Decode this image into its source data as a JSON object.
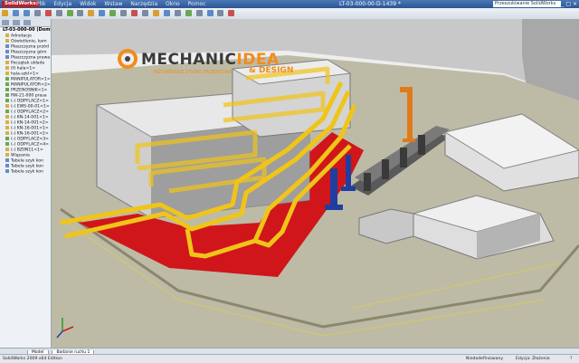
{
  "app": {
    "name": "SolidWorks",
    "menu": [
      "Plik",
      "Edycja",
      "Widok",
      "Wstaw",
      "Narzędzia",
      "Okno",
      "Pomoc"
    ],
    "document_title": "LT-03-000-00-D-1439 *",
    "search_placeholder": "Przeszukiwanie SolidWorks",
    "window_buttons": "_ □ ×"
  },
  "tree": {
    "root": "LT-03-000-00 (Domy",
    "items": [
      {
        "label": "Adnotacje",
        "icon": "annotation-icon"
      },
      {
        "label": "Oświetlenie, kam",
        "icon": "lights-icon"
      },
      {
        "label": "Płaszczyzna przód",
        "icon": "plane-icon"
      },
      {
        "label": "Płaszczyzna górn",
        "icon": "plane-icon"
      },
      {
        "label": "Płaszczyzna prawa",
        "icon": "plane-icon"
      },
      {
        "label": "Początek układu",
        "icon": "origin-icon"
      },
      {
        "label": "(f) hala<1>",
        "icon": "part-icon"
      },
      {
        "label": "hala-szkl<1>",
        "icon": "part-icon"
      },
      {
        "label": "MANIPULATOR<1>",
        "icon": "assembly-icon"
      },
      {
        "label": "MANIPULATOR<2>",
        "icon": "assembly-icon"
      },
      {
        "label": "PRZENOSNIK<1>",
        "icon": "assembly-icon"
      },
      {
        "label": "RW-21-000 prasa",
        "icon": "assembly-icon"
      },
      {
        "label": "(-) ODPYLACZ<1>",
        "icon": "assembly-icon"
      },
      {
        "label": "(-) EWS-00-01<1>",
        "icon": "part-icon"
      },
      {
        "label": "(-) ODPYLACZ<2>",
        "icon": "assembly-icon"
      },
      {
        "label": "(-) KN-14-001<1>",
        "icon": "part-icon"
      },
      {
        "label": "(-) KN-14-001<2>",
        "icon": "part-icon"
      },
      {
        "label": "(-) KN-16-001<1>",
        "icon": "part-icon"
      },
      {
        "label": "(-) KN-16-001<2>",
        "icon": "part-icon"
      },
      {
        "label": "(-) ODPYLACZ<3>",
        "icon": "assembly-icon"
      },
      {
        "label": "(-) ODPYLACZ<4>",
        "icon": "assembly-icon"
      },
      {
        "label": "(-) BZ0N11<1>",
        "icon": "part-icon"
      },
      {
        "label": "Wiązania",
        "icon": "mates-icon"
      },
      {
        "label": "Tabela szyk kon",
        "icon": "pattern-icon"
      },
      {
        "label": "Tabela szyk kon",
        "icon": "pattern-icon"
      },
      {
        "label": "Tabela szyk kon",
        "icon": "pattern-icon"
      }
    ]
  },
  "watermark": {
    "brand_left": "MECHANIC",
    "brand_right": "IDEA",
    "subtitle": "INŻYNIERSKIE STUDIO PROJEKTOWE",
    "design": "& DESIGN"
  },
  "bottom_tabs": [
    "Model",
    "Badanie ruchu 1"
  ],
  "status": {
    "left": "SolidWorks 2009 x64 Edition",
    "middle": "Niedodefiniowany",
    "right": "Edycja: Złożenie",
    "help": "?"
  },
  "colors": {
    "duct": "#f0c419",
    "floor_zone": "#d0161a",
    "manipulator": "#1e3fa0",
    "orange_post": "#e07a1a"
  }
}
